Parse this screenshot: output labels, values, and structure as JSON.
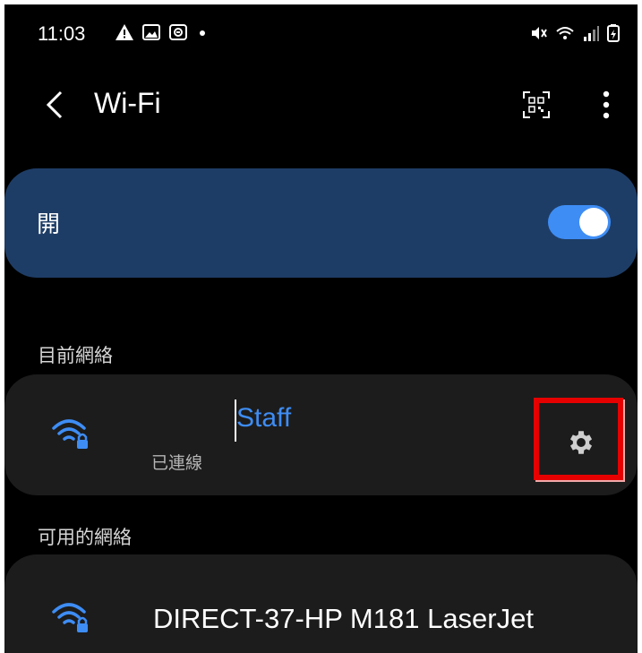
{
  "status_bar": {
    "time": "11:03",
    "left_icons": [
      "warning-icon",
      "image-icon",
      "cast-icon",
      "dot-icon"
    ],
    "right_icons": [
      "mute-icon",
      "wifi-status-icon",
      "signal-icon",
      "battery-icon"
    ]
  },
  "app_bar": {
    "title": "Wi-Fi",
    "back_icon": "chevron-left-icon",
    "qr_icon": "qr-code-icon",
    "more_icon": "more-vert-icon"
  },
  "master_toggle": {
    "label": "開",
    "state": "on"
  },
  "current_network": {
    "section_title": "目前網絡",
    "ssid": "Staff",
    "status": "已連線",
    "settings_icon": "gear-icon"
  },
  "available_networks": {
    "section_title": "可用的網絡",
    "items": [
      {
        "ssid": "DIRECT-37-HP M181 LaserJet",
        "secured": true
      }
    ]
  },
  "colors": {
    "accent": "#3e8df5",
    "master_card": "#1e3d66",
    "card": "#1c1c1c",
    "highlight": "#e60000"
  }
}
